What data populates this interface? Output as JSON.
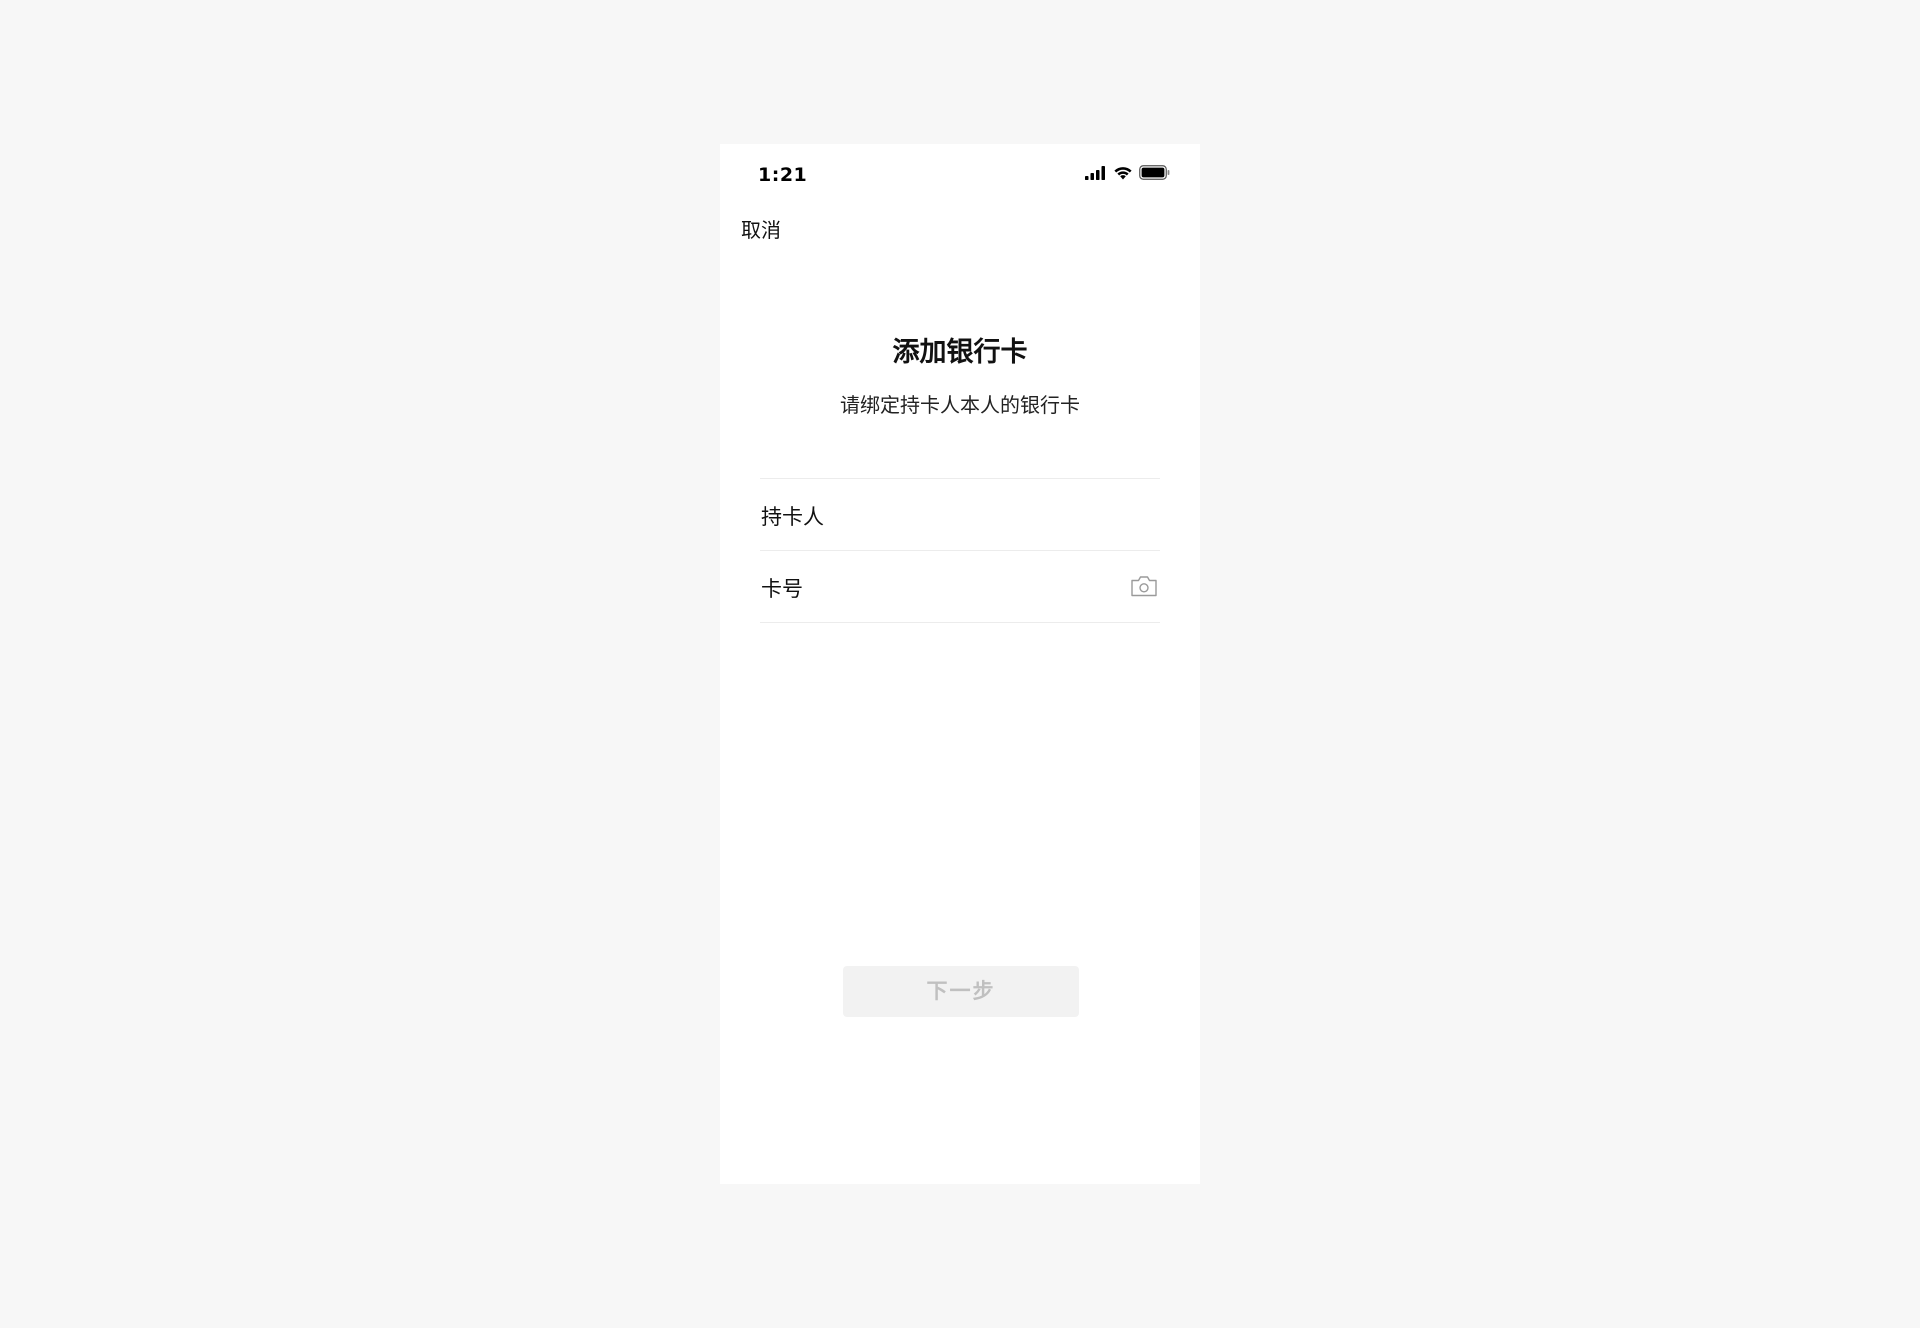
{
  "status_bar": {
    "time": "1:21",
    "icons": [
      "cellular-signal-icon",
      "wifi-icon",
      "battery-icon"
    ]
  },
  "nav": {
    "cancel_label": "取消"
  },
  "header": {
    "title": "添加银行卡",
    "subtitle": "请绑定持卡人本人的银行卡"
  },
  "form": {
    "fields": [
      {
        "label": "持卡人",
        "value": ""
      },
      {
        "label": "卡号",
        "value": "",
        "trailing_icon": "camera-icon"
      }
    ]
  },
  "footer": {
    "next_label": "下一步",
    "next_enabled": false
  },
  "colors": {
    "page_background": "#f7f7f7",
    "screen_background": "#ffffff",
    "divider": "#ececec",
    "disabled_button_bg": "#f2f2f2",
    "disabled_button_text": "#c0c0c0"
  }
}
